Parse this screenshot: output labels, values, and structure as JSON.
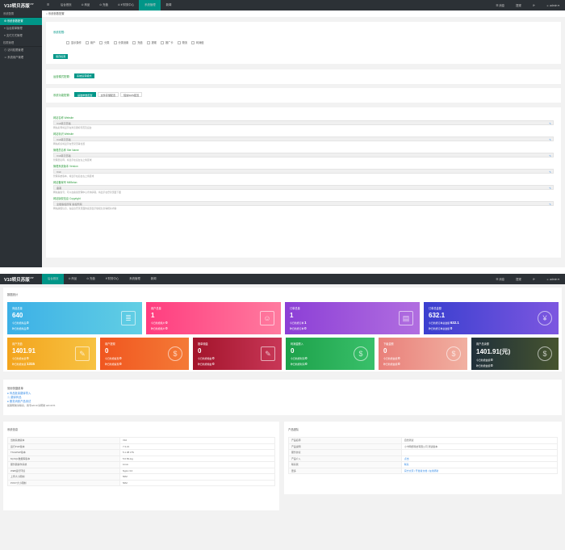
{
  "screen1": {
    "brand": "V10转贝苏版",
    "brand_ver": "VIP",
    "nav": [
      {
        "icon": "☰",
        "label": ""
      },
      {
        "icon": "",
        "label": "后台首页"
      },
      {
        "icon": "⊙",
        "label": "商品"
      },
      {
        "icon": "⊙",
        "label": "充值"
      },
      {
        "icon": "⊙",
        "label": "¥ 财务中心"
      },
      {
        "icon": "",
        "label": "系统管理",
        "active": true
      },
      {
        "icon": "",
        "label": "新闻"
      }
    ],
    "header_right": [
      {
        "label": "☰ 消息",
        "badge": "1"
      },
      {
        "label": "提现",
        "badge": "0"
      },
      {
        "label": "⟳",
        "badge": ""
      },
      {
        "label": "☺ admin ▾",
        "badge": ""
      }
    ],
    "sidebar": [
      {
        "type": "group",
        "label": "系统配置"
      },
      {
        "type": "item",
        "label": "⚙ 系统参数配置",
        "active": true
      },
      {
        "type": "item",
        "label": "≡ 后台菜单管理"
      },
      {
        "type": "item",
        "label": "≡ 支付方式管理"
      },
      {
        "type": "group",
        "label": "权限管理"
      },
      {
        "type": "item",
        "label": "⊙ 访问权限管理"
      },
      {
        "type": "item",
        "label": "☺ 系统用户管理"
      }
    ],
    "breadcrumb": "⌂ 系统参数配置",
    "perm_label": "系统权限：",
    "perm_items": [
      "显示操作",
      "用户",
      "分类",
      "分类设置",
      "充值",
      "提现",
      "推广卡",
      "物流",
      "利润值"
    ],
    "save_perm": "保存权限",
    "mode_label": "运营模式配置：",
    "mode_button": "系统运营模式",
    "params_label": "系统功能配置：",
    "tabs": [
      "基础参数配置",
      "文件存储配置",
      "短信SMS配置"
    ],
    "fields": [
      {
        "title": "网站名称 Website",
        "value": "V10转贝苏版",
        "hint": "网站名称将显示在浏览器标签页及后台"
      },
      {
        "title": "网站标识 Website",
        "value": "V10转贝苏版",
        "hint": "网站标识将显示在登录页等位置"
      },
      {
        "title": "管理员名称 Site Name",
        "value": "V10转贝苏版",
        "hint": "管理员名称，将显示在后台左上角区域"
      },
      {
        "title": "管理系统版本 Version",
        "value": "V10",
        "hint": "管理系统版本，将显示在后台左上角区域"
      },
      {
        "title": "网站备案号 MIIBeian",
        "value": "备案",
        "hint": "网站备案号，可以在备案管理中心查询获取，将显示在登录页面下面"
      },
      {
        "title": "网站版权信息 Copyright",
        "value": "全能版权所有 版权所有",
        "hint": "网站版权信息，在后台登录页面的底部显示版权信息等相关内容"
      }
    ]
  },
  "screen2": {
    "brand": "V10转贝苏版",
    "brand_ver": "VIP",
    "nav": [
      {
        "icon": "",
        "label": "后台首页",
        "active": true
      },
      {
        "icon": "⊙",
        "label": "商品"
      },
      {
        "icon": "⊙",
        "label": "充值"
      },
      {
        "icon": "",
        "label": "¥ 财务中心"
      },
      {
        "icon": "",
        "label": "系统管理"
      },
      {
        "icon": "",
        "label": "新闻"
      }
    ],
    "header_right": [
      {
        "label": "☰ 消息",
        "badge": "1"
      },
      {
        "label": "提现",
        "badge": "0"
      },
      {
        "label": "⟳",
        "badge": ""
      },
      {
        "label": "☺ admin ▾",
        "badge": ""
      }
    ],
    "stats_title": "数据统计",
    "tiles": [
      {
        "title": "商品总量",
        "value": "640",
        "l1": "今日新增商品",
        "v1": "0",
        "l2": "昨日新增商品",
        "v2": "0",
        "bg": "linear-gradient(90deg,#3cb0e6,#62cfe4)",
        "icon": "≣",
        "sq": true
      },
      {
        "title": "用户总量",
        "value": "1",
        "l1": "今日新增用户",
        "v1": "0",
        "l2": "昨日新增用户",
        "v2": "0",
        "bg": "linear-gradient(90deg,#ff3d7f,#ff7b9f)",
        "icon": "☺",
        "sq": true
      },
      {
        "title": "订单总量",
        "value": "1",
        "l1": "今日新增订单",
        "v1": "1",
        "l2": "昨日新增订单",
        "v2": "0",
        "bg": "linear-gradient(90deg,#8c3fd6,#b16ee0)",
        "icon": "▤",
        "sq": true
      },
      {
        "title": "订单总金额",
        "value": "632.1",
        "l1": "今日新增订单总金额",
        "v1": "632.1",
        "l2": "昨日新增订单总金额",
        "v2": "0",
        "bg": "linear-gradient(90deg,#3a3fcf,#7d57e0)",
        "icon": "¥",
        "sq": false
      },
      {
        "title": "用户充值",
        "value": "1401.91",
        "l1": "今日新增充值",
        "v1": "0",
        "l2": "昨日新增充值",
        "v2": "1315",
        "bg": "linear-gradient(90deg,#f3a41d,#f7c242)",
        "icon": "✎",
        "sq": true
      },
      {
        "title": "用户提现",
        "value": "0",
        "l1": "今日新增提现",
        "v1": "0",
        "l2": "昨日新增提现",
        "v2": "0",
        "bg": "linear-gradient(90deg,#f0561f,#f47a37)",
        "icon": "$",
        "sq": false
      },
      {
        "title": "推单佣金",
        "value": "0",
        "l1": "今日新增佣金",
        "v1": "0",
        "l2": "昨日新增佣金",
        "v2": "0",
        "bg": "linear-gradient(90deg,#a3142b,#c83757)",
        "icon": "✎",
        "sq": true
      },
      {
        "title": "利润金额入",
        "value": "0",
        "l1": "今日新增利润",
        "v1": "0",
        "l2": "昨日新增利润",
        "v2": "0",
        "bg": "linear-gradient(90deg,#1da14a,#39c06a)",
        "icon": "$",
        "sq": false
      },
      {
        "title": "下级金额",
        "value": "0",
        "l1": "今日新增金额",
        "v1": "0",
        "l2": "昨日新增金额",
        "v2": "0",
        "bg": "linear-gradient(90deg,#e9807a,#f1b0a1)",
        "icon": "$",
        "sq": false
      },
      {
        "title": "用户总余额",
        "value": "1401.91(元)",
        "l1": "今日新增金额",
        "v1": "0",
        "l2": "昨日新增金额",
        "v2": "0",
        "bg": "linear-gradient(90deg,#20303a,#46542f)",
        "icon": "$",
        "sq": false
      }
    ],
    "links_title": "常用快捷菜单",
    "links": [
      "● 商品批量翻译导入",
      "☆ 翻译商品",
      "● 服务消费产品测试"
    ],
    "links_note": "如需帮助请联系，我专admin请帮助 admin01",
    "sys_title": "系统信息",
    "sys_rows": [
      [
        "当前系统版本",
        "V10"
      ],
      [
        "运行PHP版本",
        "7.3.21"
      ],
      [
        "ThinkPHP版本",
        "5.1.38 LTS"
      ],
      [
        "MySQL数据库版本",
        "5.6.50-log"
      ],
      [
        "服务器操作系统",
        "Linux"
      ],
      [
        "WEB运行环境",
        "Nginx 3.0"
      ],
      [
        "上传大小限制",
        "50M"
      ],
      [
        "POST大小限制",
        "50M"
      ]
    ],
    "prod_title": "产品团队",
    "prod_rows": [
      [
        "产品名称",
        "自然测试"
      ],
      [
        "产品说明",
        "小卡网络科技有限公司 测试版本"
      ],
      [
        "服务协议",
        ""
      ],
      [
        "产品介入",
        "点击"
      ],
      [
        "联系我",
        "联系"
      ],
      [
        "更多",
        "官方交流 | 开发者文档 | 在线帮助"
      ]
    ]
  }
}
